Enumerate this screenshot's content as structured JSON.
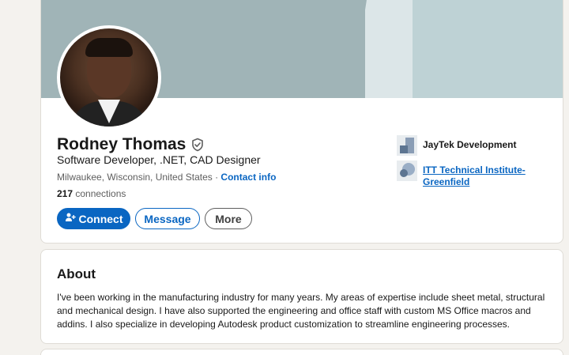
{
  "profile": {
    "name": "Rodney Thomas",
    "headline": "Software Developer, .NET, CAD Designer",
    "location": "Milwaukee, Wisconsin, United States",
    "location_separator": " · ",
    "contact_info_label": "Contact info",
    "connections_count": "217",
    "connections_label": " connections"
  },
  "actions": {
    "connect_label": "Connect",
    "message_label": "Message",
    "more_label": "More"
  },
  "experience": {
    "current_company": "JayTek Development",
    "education": "ITT Technical Institute-Greenfield"
  },
  "about": {
    "title": "About",
    "text": "I've been working in the manufacturing industry for many years. My areas of expertise include sheet metal, structural and mechanical design. I have also supported the engineering and office staff with custom MS Office macros and addins. I also specialize in developing Autodesk product customization to streamline engineering processes."
  },
  "icons": {
    "verified": "shield-check-icon",
    "connect": "add-person-icon"
  },
  "colors": {
    "accent": "#0a66c2",
    "background": "#f4f2ee",
    "cover": "#a0b4b7"
  }
}
